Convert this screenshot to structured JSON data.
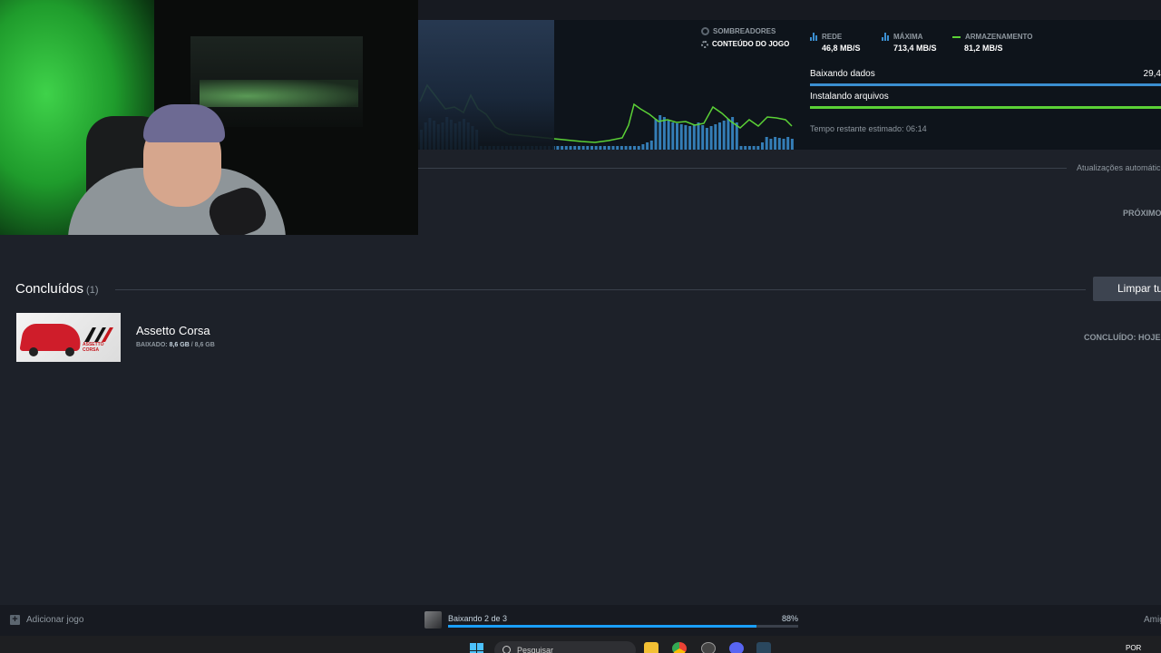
{
  "stats": {
    "shaders_label": "SOMBREADORES",
    "content_label": "CONTEÚDO DO JOGO",
    "network": {
      "label": "REDE",
      "value": "46,8 Mb/s"
    },
    "peak": {
      "label": "MÁXIMA",
      "value": "713,4 Mb/s"
    },
    "storage": {
      "label": "ARMAZENAMENTO",
      "value": "81,2 Mb/s"
    },
    "downloading_label": "Baixando dados",
    "downloading_value": "29,4",
    "installing_label": "Instalando arquivos",
    "time_remaining": "Tempo restante estimado: 06:14",
    "colors": {
      "network": "#3b8fd1",
      "storage": "#5bd136",
      "download_bar": "#3b8fd1",
      "install_bar": "#5bd136"
    }
  },
  "auto_updates_label": "Atualizações automátic",
  "next_label": "PRÓXIMO",
  "completed": {
    "title": "Concluídos",
    "count": "(1)",
    "clear_button": "Limpar tu",
    "items": [
      {
        "name": "Assetto Corsa",
        "downloaded_label": "BAIXADO:",
        "downloaded_value": "8,6 GB",
        "total": "/ 8,6 GB",
        "status": "CONCLUÍDO: HOJE",
        "logo_text": "ASSETTO CORSA"
      }
    ]
  },
  "footer": {
    "add_game": "Adicionar jogo",
    "download_status": "Baixando 2 de 3",
    "download_percent": "88%",
    "download_progress": 0.88,
    "friends": "Amig"
  },
  "taskbar": {
    "search_placeholder": "Pesquisar",
    "language": "POR",
    "icons": [
      "windows-icon",
      "file-explorer-icon",
      "chrome-icon",
      "app-icon",
      "discord-icon",
      "steam-icon"
    ]
  }
}
